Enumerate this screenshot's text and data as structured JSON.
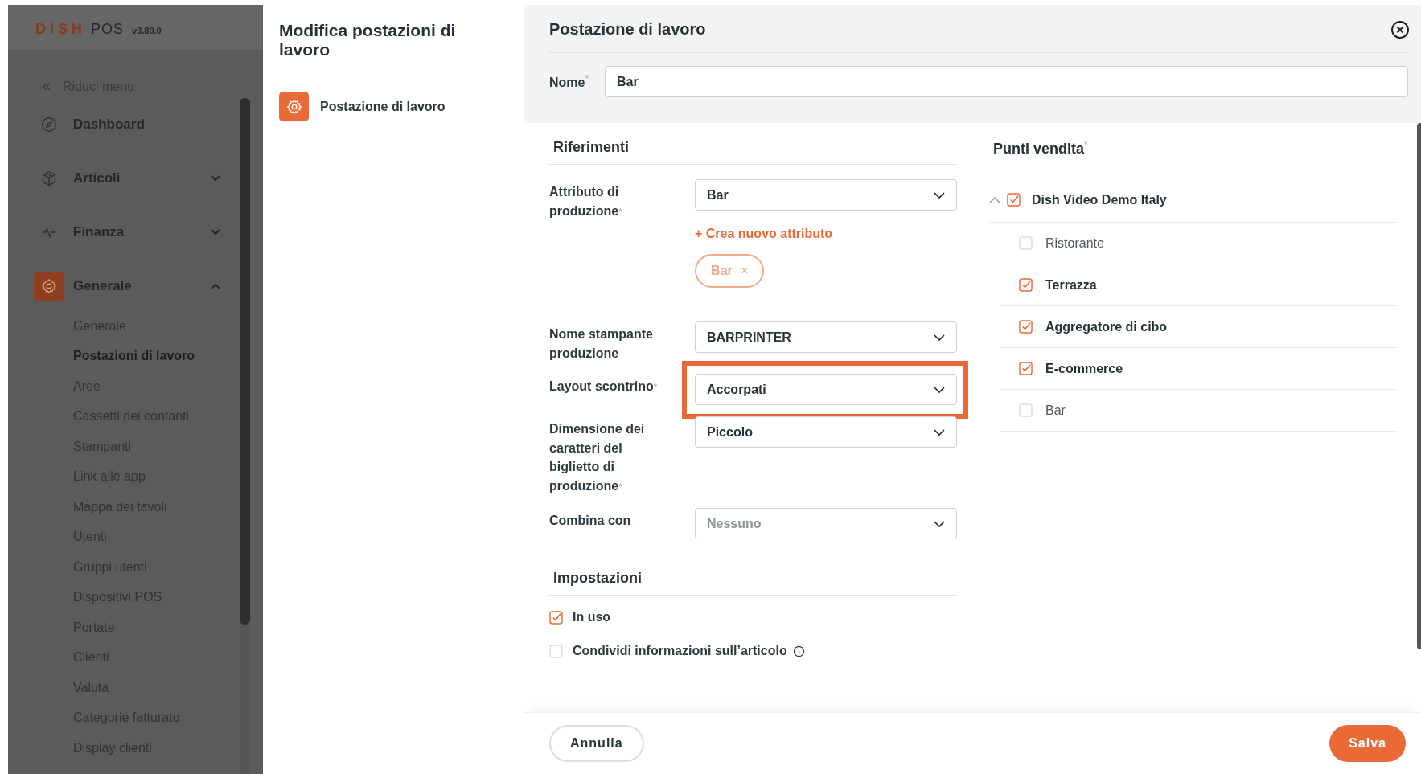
{
  "sidebar": {
    "logo": {
      "brand": "DISH",
      "product": "POS",
      "version": "v3.80.0"
    },
    "collapse": "Riduci menu",
    "items": [
      {
        "label": "Dashboard",
        "selected": false
      },
      {
        "label": "Articoli",
        "selected": false,
        "expanded": false
      },
      {
        "label": "Finanza",
        "selected": false,
        "expanded": false
      },
      {
        "label": "Generale",
        "selected": true,
        "expanded": true,
        "children": [
          {
            "label": "Generale",
            "selected": false
          },
          {
            "label": "Postazioni di lavoro",
            "selected": true
          },
          {
            "label": "Aree",
            "selected": false
          },
          {
            "label": "Cassetti dei contanti",
            "selected": false
          },
          {
            "label": "Stampanti",
            "selected": false
          },
          {
            "label": "Link alle app",
            "selected": false
          },
          {
            "label": "Mappa dei tavoli",
            "selected": false
          },
          {
            "label": "Utenti",
            "selected": false
          },
          {
            "label": "Gruppi utenti",
            "selected": false
          },
          {
            "label": "Dispositivi POS",
            "selected": false
          },
          {
            "label": "Portate",
            "selected": false
          },
          {
            "label": "Clienti",
            "selected": false
          },
          {
            "label": "Valuta",
            "selected": false
          },
          {
            "label": "Categorie fatturato",
            "selected": false
          },
          {
            "label": "Display clienti",
            "selected": false
          }
        ]
      }
    ]
  },
  "middle": {
    "title": "Modifica postazioni di lavoro",
    "items": [
      {
        "label": "Postazione di lavoro",
        "selected": true
      }
    ]
  },
  "required_mark": "*",
  "form": {
    "title": "Postazione di lavoro",
    "name": {
      "label": "Nome",
      "required": true,
      "value": "Bar"
    },
    "references": {
      "heading": "Riferimenti",
      "fields": [
        {
          "label": "Attributo di produzione",
          "required": true,
          "value": "Bar",
          "highlighted": false,
          "link": "+ Crea nuovo attributo",
          "chips": [
            {
              "label": "Bar",
              "remove": "×"
            }
          ]
        },
        {
          "label": "Nome stampante produzione",
          "required": false,
          "value": "BARPRINTER",
          "highlighted": false
        },
        {
          "label": "Layout scontrino",
          "required": true,
          "value": "Accorpati",
          "highlighted": true
        },
        {
          "label": "Dimensione dei caratteri del biglietto di produzione",
          "required": true,
          "value": "Piccolo",
          "highlighted": false
        },
        {
          "label": "Combina con",
          "required": false,
          "placeholder": "Nessuno",
          "highlighted": false
        }
      ]
    },
    "settings": {
      "heading": "Impostazioni",
      "options": [
        {
          "label": "In uso",
          "checked": true,
          "info": false
        },
        {
          "label": "Condividi informazioni sull’articolo",
          "checked": false,
          "info": true
        }
      ]
    },
    "outlets": {
      "heading": "Punti vendita",
      "required": true,
      "tree": [
        {
          "label": "Dish Video Demo Italy",
          "checked": true,
          "expanded": true,
          "children": [
            {
              "label": "Ristorante",
              "checked": false
            },
            {
              "label": "Terrazza",
              "checked": true
            },
            {
              "label": "Aggregatore di cibo",
              "checked": true
            },
            {
              "label": "E-commerce",
              "checked": true
            },
            {
              "label": "Bar",
              "checked": false
            }
          ]
        }
      ]
    }
  },
  "footer": {
    "cancel": "Annulla",
    "save": "Salva"
  }
}
